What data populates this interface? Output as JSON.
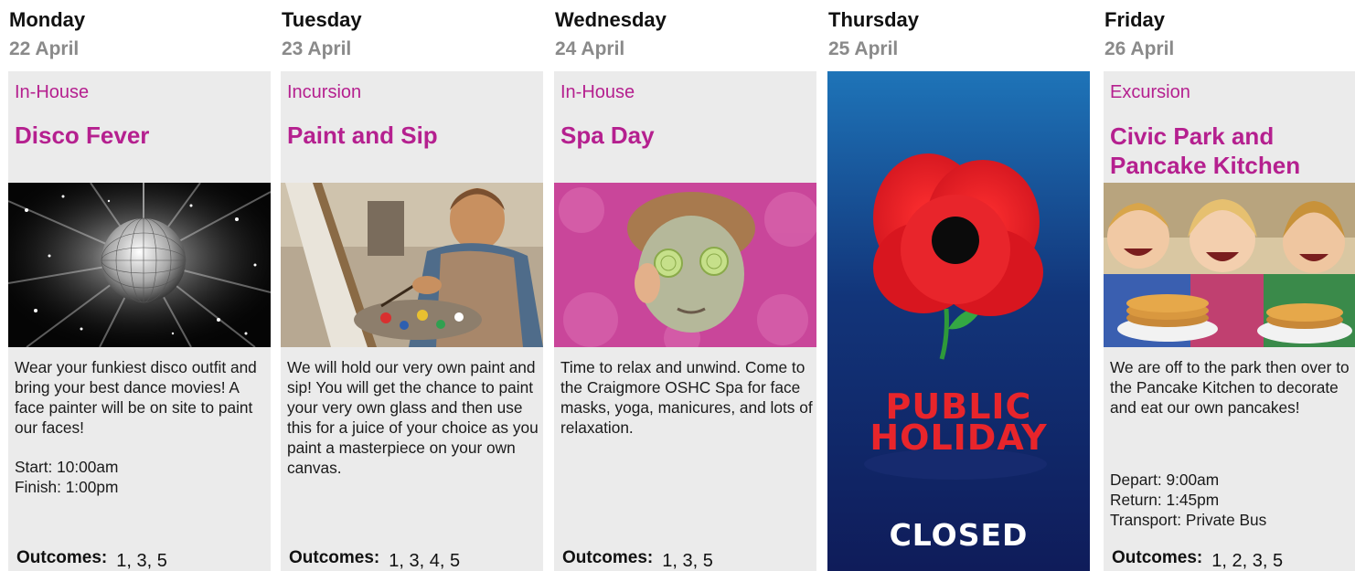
{
  "days": [
    {
      "day": "Monday",
      "date": "22 April",
      "category": "In-House",
      "title": "Disco Fever",
      "description": "Wear your funkiest disco outfit and bring your best dance movies! A face painter will be on site to paint our faces!",
      "details": [
        "Start: 10:00am",
        "Finish: 1:00pm"
      ],
      "outcomes_label": "Outcomes:",
      "outcomes": "1, 3, 5"
    },
    {
      "day": "Tuesday",
      "date": "23 April",
      "category": "Incursion",
      "title": "Paint and Sip",
      "description": "We will hold our very own paint and sip! You will get the chance to paint your very own glass and then use this for a juice of your choice as you paint a masterpiece on your own canvas.",
      "outcomes_label": "Outcomes:",
      "outcomes": "1, 3, 4, 5"
    },
    {
      "day": "Wednesday",
      "date": "24 April",
      "category": "In-House",
      "title": "Spa Day",
      "description": "Time to relax and unwind. Come to the Craigmore OSHC Spa for face masks, yoga, manicures, and lots of relaxation.",
      "outcomes_label": "Outcomes:",
      "outcomes": "1, 3, 5"
    },
    {
      "day": "Thursday",
      "date": "25 April",
      "holiday_line1": "PUBLIC",
      "holiday_line2": "HOLIDAY",
      "closed": "CLOSED"
    },
    {
      "day": "Friday",
      "date": "26 April",
      "category": "Excursion",
      "title": "Civic Park and Pancake Kitchen",
      "description": "We are off to the park then over to the Pancake Kitchen to decorate and eat our own pancakes!",
      "details": [
        "Depart: 9:00am",
        "Return: 1:45pm",
        "Transport: Private Bus"
      ],
      "outcomes_label": "Outcomes:",
      "outcomes": "1, 2, 3, 5"
    }
  ],
  "colors": {
    "accent": "#b5208f",
    "card_bg": "#ebebeb",
    "date_gray": "#8a8a8a",
    "holiday_top": "#1e74b8",
    "holiday_bottom": "#0f1c5a",
    "poppy_red": "#e8252b"
  },
  "icons": {
    "monday_photo": "disco-ball-image",
    "tuesday_photo": "child-painting-image",
    "wednesday_photo": "spa-face-mask-image",
    "thursday_graphic": "poppy-flower-icon",
    "friday_photo": "children-pancakes-image"
  }
}
